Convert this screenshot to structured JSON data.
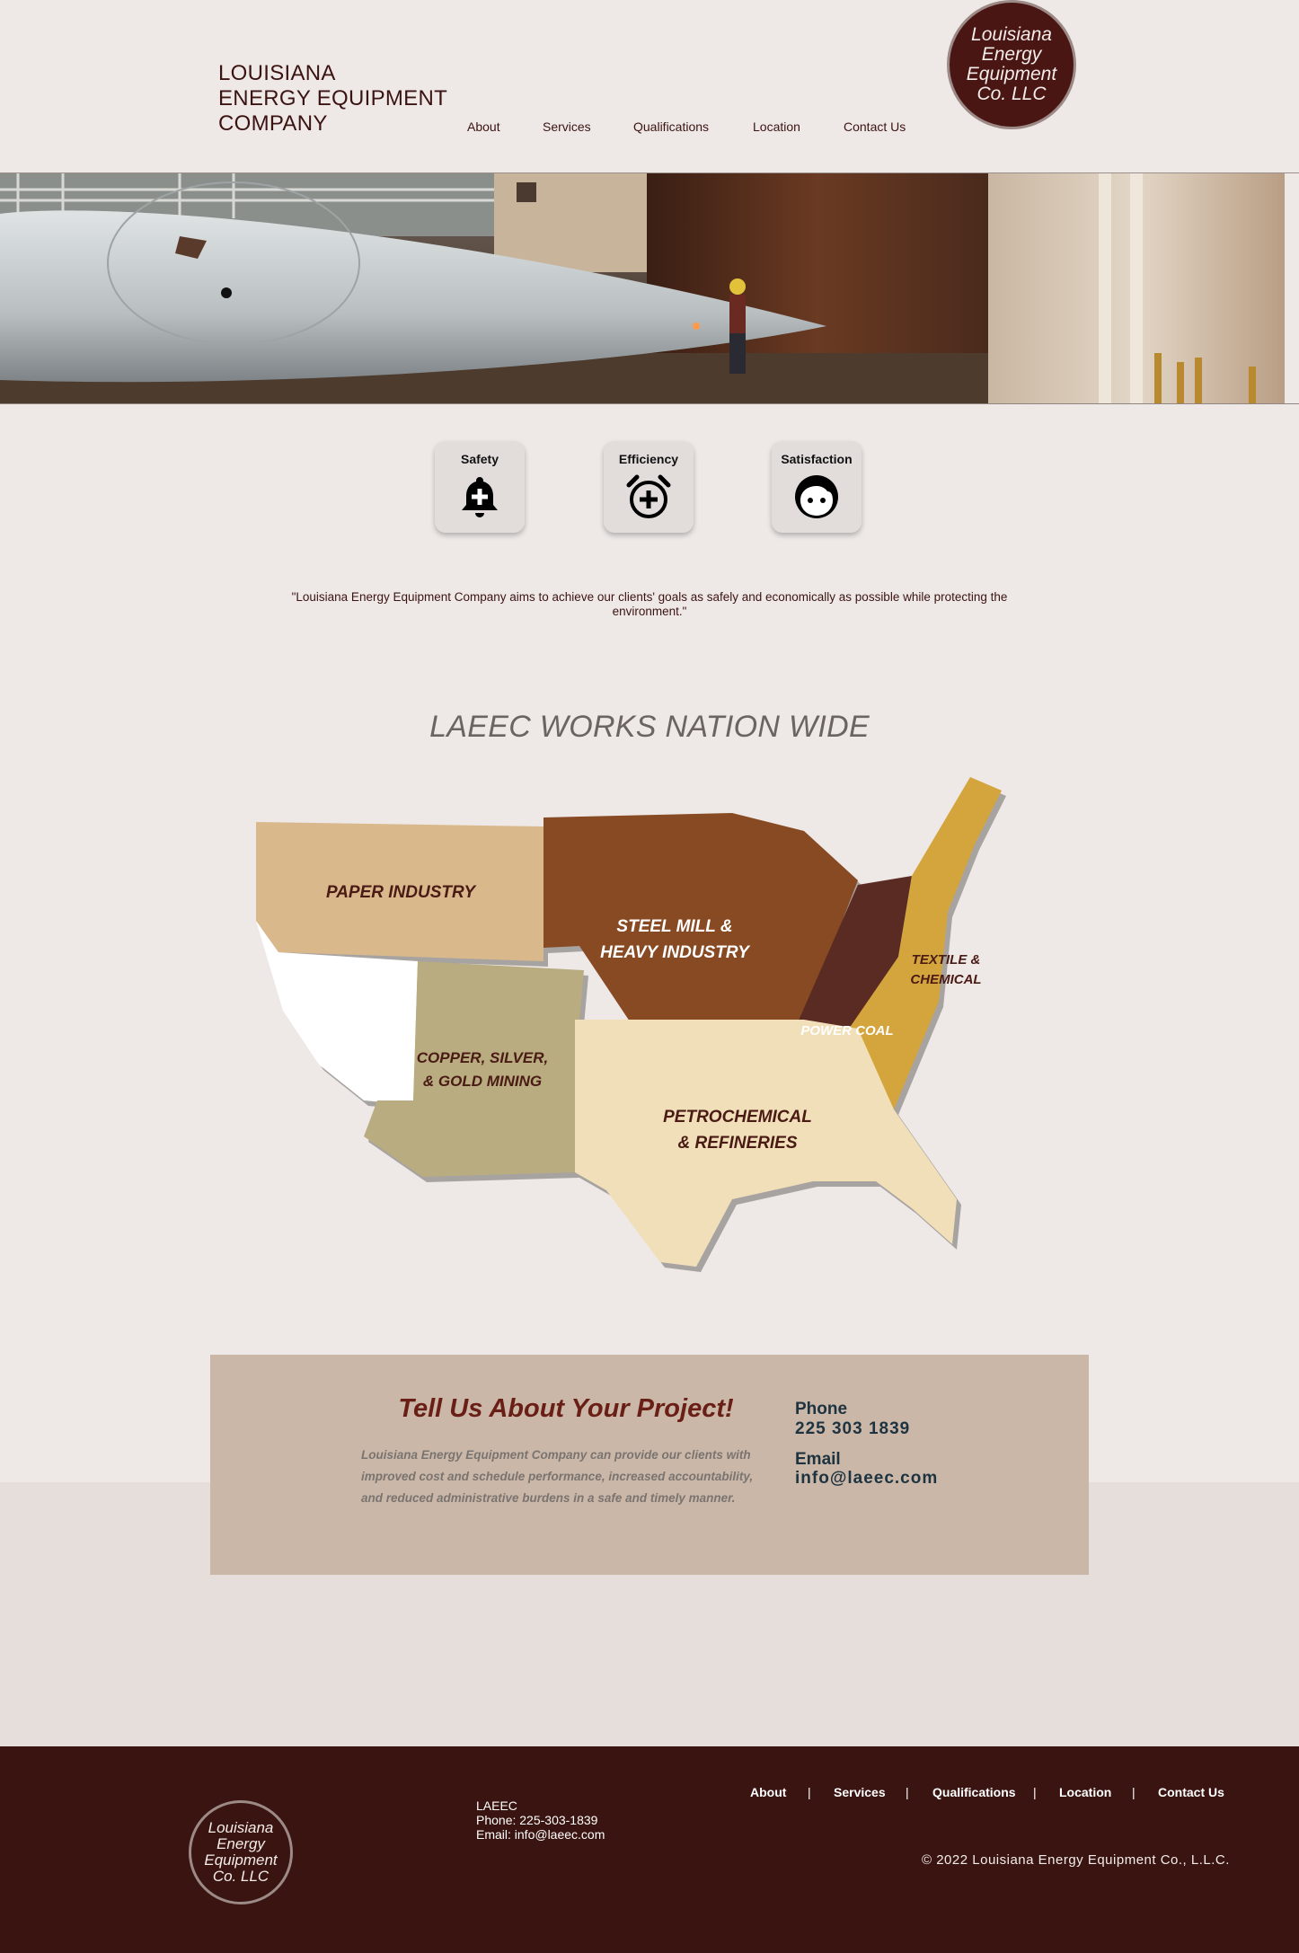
{
  "header": {
    "brand_lines": [
      "LOUISIANA",
      "ENERGY EQUIPMENT",
      "COMPANY"
    ],
    "nav": [
      "About",
      "Services",
      "Qualifications",
      "Location",
      "Contact Us"
    ],
    "logo_lines": [
      "Louisiana",
      "Energy",
      "Equipment",
      "Co. LLC"
    ]
  },
  "values": [
    {
      "label": "Safety",
      "icon": "bell-plus-icon"
    },
    {
      "label": "Efficiency",
      "icon": "alarm-plus-icon"
    },
    {
      "label": "Satisfaction",
      "icon": "face-icon"
    }
  ],
  "mission_quote": "\"Louisiana Energy Equipment Company aims to achieve our clients' goals as safely and economically as possible while protecting the environment.\"",
  "map": {
    "title": "LAEEC WORKS NATION WIDE",
    "regions": [
      {
        "lines": [
          "PAPER INDUSTRY"
        ],
        "color": "#d9b98c"
      },
      {
        "lines": [
          "STEEL MILL &",
          "HEAVY INDUSTRY"
        ],
        "color": "#874a22"
      },
      {
        "lines": [
          "TEXTILE &",
          "CHEMICAL"
        ],
        "color": "#d4a43d"
      },
      {
        "lines": [
          "POWER COAL"
        ],
        "color": "#5a2b22"
      },
      {
        "lines": [
          "COPPER, SILVER,",
          "& GOLD MINING"
        ],
        "color": "#b8ac80"
      },
      {
        "lines": [
          "PETROCHEMICAL",
          "& REFINERIES"
        ],
        "color": "#f0dfb8"
      },
      {
        "lines": [],
        "color": "#ffffff"
      }
    ]
  },
  "contact": {
    "heading": "Tell Us About Your Project!",
    "body": "Louisiana Energy Equipment Company can provide our clients with improved cost and schedule performance, increased accountability, and reduced administrative burdens in a safe and timely manner.",
    "phone_label": "Phone",
    "phone": "225 303 1839",
    "email_label": "Email",
    "email": "info@laeec.com"
  },
  "footer": {
    "logo_lines": [
      "Louisiana",
      "Energy",
      "Equipment",
      "Co. LLC"
    ],
    "company": "LAEEC",
    "phone_line": "Phone: 225-303-1839",
    "email_line": "Email: info@laeec.com",
    "nav": [
      "About",
      "Services",
      "Qualifications",
      "Location",
      "Contact Us"
    ],
    "separator": "|",
    "copyright": "© 2022 Louisiana Energy Equipment Co., L.L.C."
  },
  "colors": {
    "background": "#eee9e7",
    "brand_dark": "#3a1410",
    "contact_box": "#cab7a8",
    "cta_red": "#6a1f16",
    "contact_text": "#1e3340"
  }
}
